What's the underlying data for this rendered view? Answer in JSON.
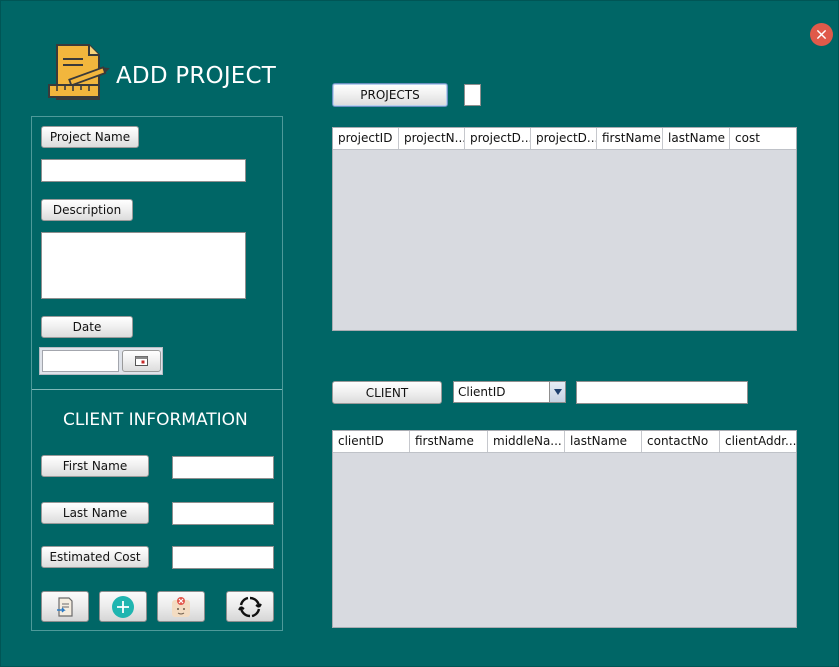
{
  "window": {
    "title": "ADD PROJECT",
    "close_icon": "close-icon",
    "close_color": "#e05a4a",
    "background": "#006666"
  },
  "form": {
    "project_name_label": "Project Name",
    "project_name_value": "",
    "description_label": "Description",
    "description_value": "",
    "date_label": "Date",
    "date_value": "",
    "calendar_icon": "calendar-icon"
  },
  "client_info": {
    "title": "CLIENT INFORMATION",
    "first_name_label": "First Name",
    "first_name_value": "",
    "last_name_label": "Last Name",
    "last_name_value": "",
    "estimated_cost_label": "Estimated Cost",
    "estimated_cost_value": ""
  },
  "actions": [
    {
      "name": "edit-document-button",
      "icon": "document-edit-icon"
    },
    {
      "name": "add-button",
      "icon": "plus-circle-icon"
    },
    {
      "name": "delete-button",
      "icon": "delete-icon"
    },
    {
      "name": "refresh-button",
      "icon": "refresh-icon"
    }
  ],
  "projects": {
    "button_label": "PROJECTS",
    "search_value": "",
    "columns": [
      "projectID",
      "projectN...",
      "projectD...",
      "projectD...",
      "firstName",
      "lastName",
      "cost"
    ],
    "rows": []
  },
  "clients": {
    "button_label": "CLIENT",
    "filter_selected": "ClientID",
    "search_value": "",
    "columns": [
      "clientID",
      "firstName",
      "middleNa...",
      "lastName",
      "contactNo",
      "clientAddr..."
    ],
    "rows": []
  }
}
